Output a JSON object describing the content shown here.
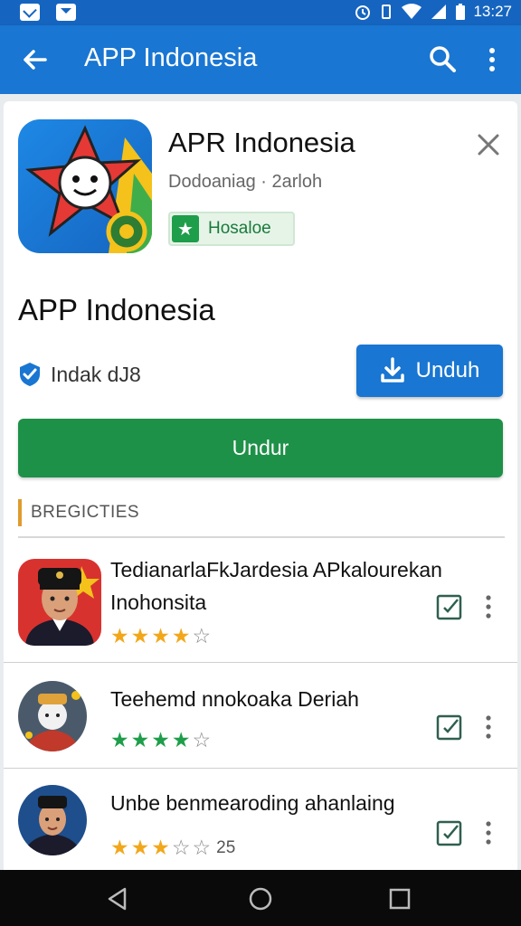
{
  "status_bar": {
    "time": "13:27"
  },
  "app_bar": {
    "title": "APP Indonesia"
  },
  "app_header": {
    "name": "APR Indonesia",
    "subtitle": "Dodoaniag · 2arloh",
    "badge_label": "Hosaloe"
  },
  "main": {
    "title": "APP Indonesia",
    "verified_text": "Indak dJ8",
    "download_button": "Unduh",
    "wide_button": "Undur"
  },
  "recommendations": {
    "header": "BREGICTIES",
    "items": [
      {
        "name": "TedianarlaFkJardesia APkalourekan Inohonsita",
        "rating": 4,
        "max": 5,
        "star_color": "#f2a71b",
        "extra": ""
      },
      {
        "name": "Teehemd nnokoaka Deriah",
        "rating": 4,
        "max": 5,
        "star_color": "#1e9e4a",
        "extra": ""
      },
      {
        "name": "Unbe benmearoding ahanlaing",
        "rating": 3,
        "max": 5,
        "star_color": "#f2a71b",
        "extra": "25"
      }
    ]
  },
  "colors": {
    "primary": "#1976d2",
    "green": "#1e9148",
    "accent": "#e09b2d"
  }
}
